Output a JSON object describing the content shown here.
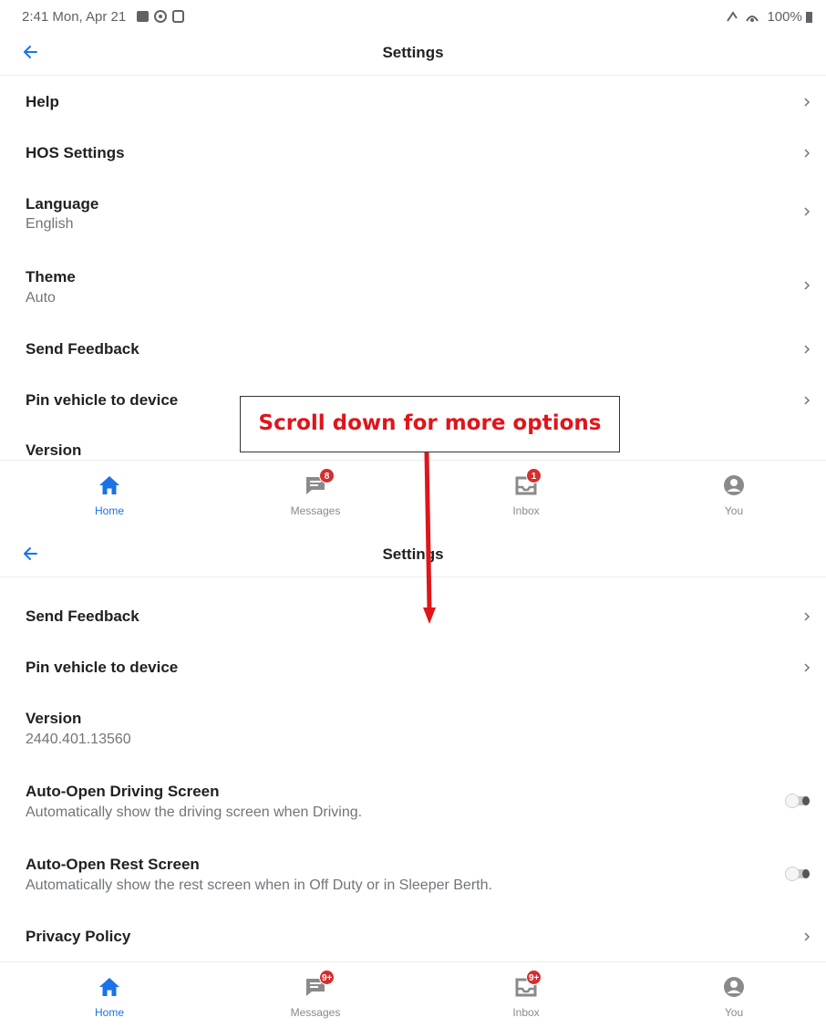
{
  "status_bar": {
    "time_date": "2:41  Mon, Apr 21",
    "battery": "100%"
  },
  "screen_top": {
    "title": "Settings",
    "rows": [
      {
        "label": "Help",
        "sub": ""
      },
      {
        "label": "HOS Settings",
        "sub": ""
      },
      {
        "label": "Language",
        "sub": "English"
      },
      {
        "label": "Theme",
        "sub": "Auto"
      },
      {
        "label": "Send Feedback",
        "sub": ""
      },
      {
        "label": "Pin vehicle to device",
        "sub": ""
      },
      {
        "label": "Version",
        "sub": ""
      }
    ],
    "tabs": [
      {
        "label": "Home",
        "badge": ""
      },
      {
        "label": "Messages",
        "badge": "8"
      },
      {
        "label": "Inbox",
        "badge": "1"
      },
      {
        "label": "You",
        "badge": ""
      }
    ]
  },
  "screen_bottom": {
    "title": "Settings",
    "rows": [
      {
        "label": "Send Feedback",
        "sub": ""
      },
      {
        "label": "Pin vehicle to device",
        "sub": ""
      },
      {
        "label": "Version",
        "sub": "2440.401.13560"
      },
      {
        "label": "Auto-Open Driving Screen",
        "sub": "Automatically show the driving screen when Driving.",
        "toggle_on": false
      },
      {
        "label": "Auto-Open Rest Screen",
        "sub": "Automatically show the rest screen when in Off Duty or in Sleeper Berth.",
        "toggle_on": false
      },
      {
        "label": "Privacy Policy",
        "sub": ""
      }
    ],
    "tabs": [
      {
        "label": "Home",
        "badge": ""
      },
      {
        "label": "Messages",
        "badge": "9+"
      },
      {
        "label": "Inbox",
        "badge": "9+"
      },
      {
        "label": "You",
        "badge": ""
      }
    ]
  },
  "annotation": {
    "text": "Scroll down for more options"
  },
  "colors": {
    "accent": "#1a73e8",
    "badge": "#d32f2f",
    "annotation": "#e0151b"
  }
}
